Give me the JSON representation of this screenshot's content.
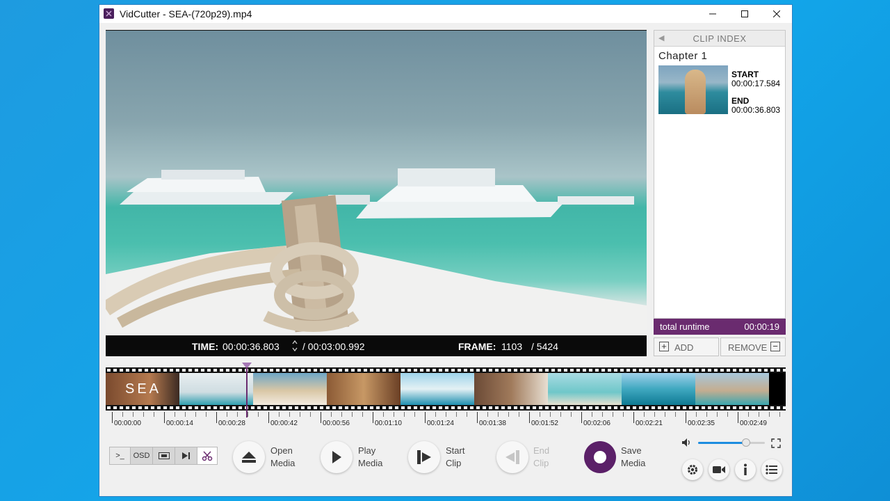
{
  "window": {
    "title": "VidCutter - SEA-(720p29).mp4",
    "app_icon": "scissors-icon"
  },
  "video": {
    "time_label": "TIME:",
    "current_time": "00:00:36.803",
    "total_time": "/ 00:03:00.992",
    "frame_label": "FRAME:",
    "current_frame": "1103",
    "total_frames": "/ 5424"
  },
  "clip_index": {
    "header": "CLIP INDEX",
    "chapter": "Chapter 1",
    "start_label": "START",
    "start_value": "00:00:17.584",
    "end_label": "END",
    "end_value": "00:00:36.803",
    "runtime_label": "total runtime",
    "runtime_value": "00:00:19",
    "add_label": "ADD",
    "remove_label": "REMOVE"
  },
  "timeline": {
    "filmstrip_text": "SEA",
    "ticks": [
      "00:00:00",
      "00:00:14",
      "00:00:28",
      "00:00:42",
      "00:00:56",
      "00:01:10",
      "00:01:24",
      "00:01:38",
      "00:01:52",
      "00:02:06",
      "00:02:21",
      "00:02:35",
      "00:02:49"
    ],
    "playhead_time": "00:00:36.803"
  },
  "toolbar": {
    "console_label": ">_",
    "osd_label": "OSD",
    "open_media": [
      "Open",
      "Media"
    ],
    "play_media": [
      "Play",
      "Media"
    ],
    "start_clip": [
      "Start",
      "Clip"
    ],
    "end_clip": [
      "End",
      "Clip"
    ],
    "save_media": [
      "Save",
      "Media"
    ],
    "volume_level": 0.72
  },
  "colors": {
    "accent": "#6a2b6f",
    "slider": "#1d8de0",
    "desktop": "#12a6ea"
  }
}
